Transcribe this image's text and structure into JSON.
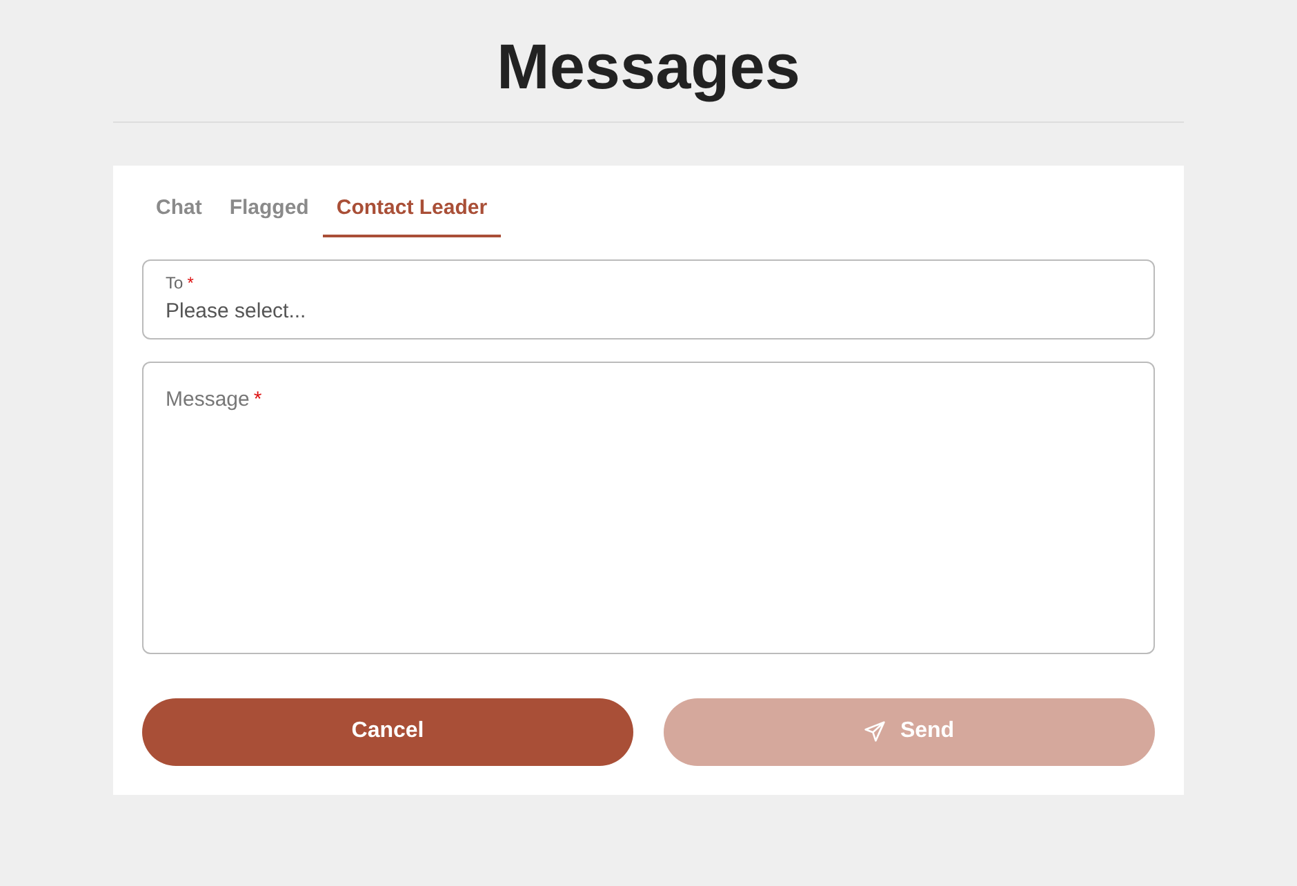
{
  "title": "Messages",
  "tabs": [
    {
      "label": "Chat",
      "selected": false
    },
    {
      "label": "Flagged",
      "selected": false
    },
    {
      "label": "Contact Leader",
      "selected": true
    }
  ],
  "to_field": {
    "label": "To",
    "required_mark": "*",
    "placeholder": "Please select..."
  },
  "message_field": {
    "label": "Message",
    "required_mark": "*"
  },
  "buttons": [
    {
      "kind": "cancel",
      "label": "Cancel",
      "disabled": false
    },
    {
      "kind": "send",
      "label": "Send",
      "disabled": true
    }
  ]
}
